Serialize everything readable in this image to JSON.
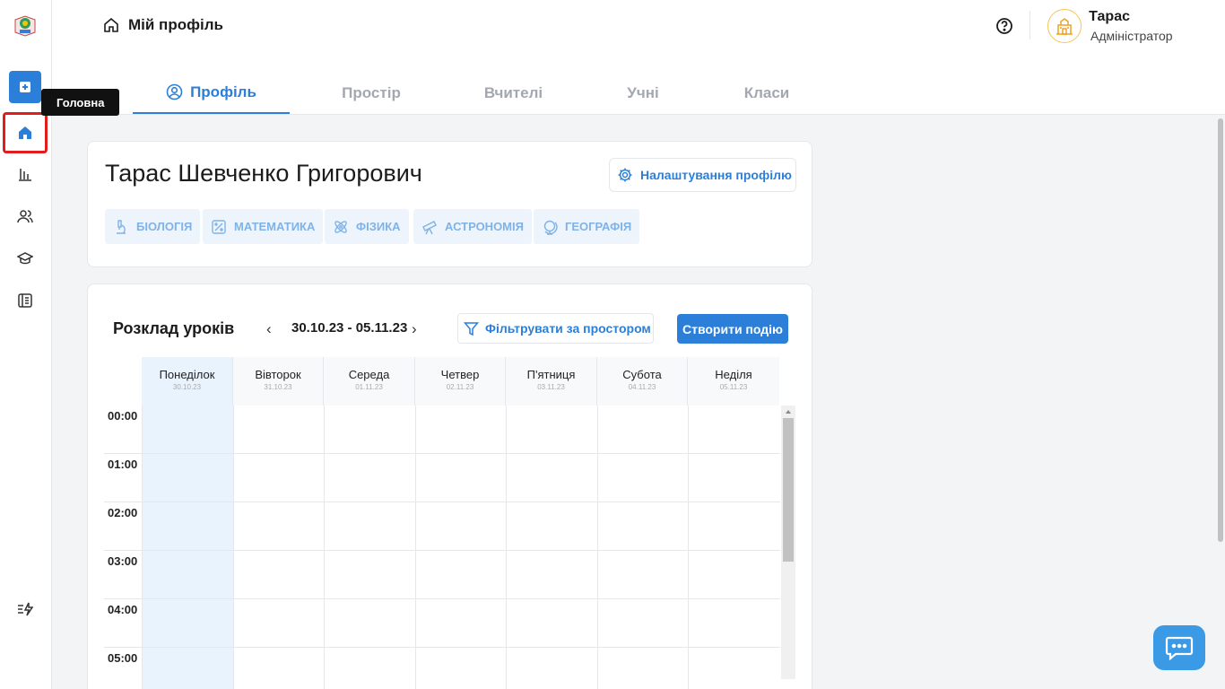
{
  "sidebar": {
    "tooltip": "Головна"
  },
  "header": {
    "breadcrumb": "Мій профіль",
    "user_name": "Тарас",
    "user_role": "Адміністратор",
    "tabs": [
      {
        "label": "Профіль",
        "active": true
      },
      {
        "label": "Простір",
        "active": false
      },
      {
        "label": "Вчителі",
        "active": false
      },
      {
        "label": "Учні",
        "active": false
      },
      {
        "label": "Класи",
        "active": false
      }
    ]
  },
  "profile": {
    "name": "Тарас Шевченко Григорович",
    "settings_label": "Налаштування профілю",
    "subjects": [
      "БІОЛОГІЯ",
      "МАТЕМАТИКА",
      "ФІЗИКА",
      "АСТРОНОМІЯ",
      "ГЕОГРАФІЯ"
    ]
  },
  "schedule": {
    "title": "Розклад уроків",
    "date_range": "30.10.23 - 05.11.23",
    "prev": "‹",
    "next": "›",
    "filter_label": "Фільтрувати за простором",
    "create_label": "Створити подію",
    "days": [
      {
        "name": "Понеділок",
        "date": "30.10.23"
      },
      {
        "name": "Вівторок",
        "date": "31.10.23"
      },
      {
        "name": "Середа",
        "date": "01.11.23"
      },
      {
        "name": "Четвер",
        "date": "02.11.23"
      },
      {
        "name": "П'ятниця",
        "date": "03.11.23"
      },
      {
        "name": "Субота",
        "date": "04.11.23"
      },
      {
        "name": "Неділя",
        "date": "05.11.23"
      }
    ],
    "times": [
      "00:00",
      "01:00",
      "02:00",
      "03:00",
      "04:00",
      "05:00"
    ]
  },
  "colors": {
    "accent": "#2b7fd9",
    "highlight": "#e11d1d",
    "today": "#e8f3fd"
  }
}
